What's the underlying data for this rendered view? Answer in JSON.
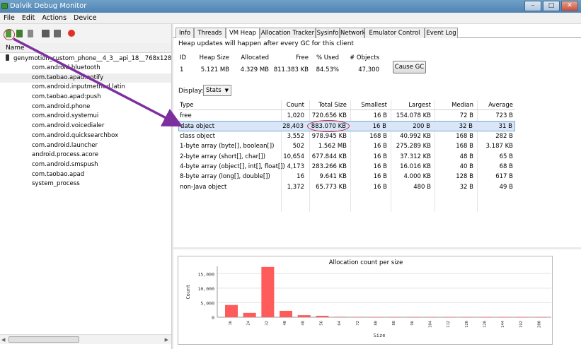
{
  "window": {
    "title": "Dalvik Debug Monitor",
    "controls": [
      "minimize-icon",
      "maximize-icon",
      "close-icon"
    ]
  },
  "menu": [
    "File",
    "Edit",
    "Actions",
    "Device"
  ],
  "left": {
    "toolbar_icons": [
      "update-heap-icon",
      "update-threads-icon",
      "dump-hprof-icon",
      "cause-gc-icon",
      "method-profiling-icon",
      "stop-process-icon"
    ],
    "name_header": "Name",
    "device": "genymotion_custom_phone__4_3__api_18__768x128",
    "clients": [
      "com.android.bluetooth",
      "com.taobao.apad:notify",
      "com.android.inputmethod.latin",
      "com.taobao.apad:push",
      "com.android.phone",
      "com.android.systemui",
      "com.android.voicedialer",
      "com.android.quicksearchbox",
      "com.android.launcher",
      "android.process.acore",
      "com.android.smspush",
      "com.taobao.apad",
      "system_process"
    ],
    "selected_client": 1
  },
  "tabs": [
    "Info",
    "Threads",
    "VM Heap",
    "Allocation Tracker",
    "Sysinfo",
    "Network",
    "Emulator Control",
    "Event Log"
  ],
  "active_tab": "VM Heap",
  "heap": {
    "note": "Heap updates will happen after every GC for this client",
    "summary_headers": [
      "ID",
      "Heap Size",
      "Allocated",
      "Free",
      "% Used",
      "# Objects"
    ],
    "summary_values": [
      "1",
      "5.121 MB",
      "4.329 MB",
      "811.383 KB",
      "84.53%",
      "47,300"
    ],
    "cause_gc": "Cause GC",
    "display_label": "Display:",
    "display_value": "Stats",
    "table_headers": [
      "Type",
      "Count",
      "Total Size",
      "Smallest",
      "Largest",
      "Median",
      "Average"
    ],
    "rows": [
      [
        "free",
        "1,020",
        "720.656 KB",
        "16 B",
        "154.078 KB",
        "72 B",
        "723 B"
      ],
      [
        "data object",
        "28,403",
        "883.070 KB",
        "16 B",
        "200 B",
        "32 B",
        "31 B"
      ],
      [
        "class object",
        "3,552",
        "978.945 KB",
        "168 B",
        "40.992 KB",
        "168 B",
        "282 B"
      ],
      [
        "1-byte array (byte[], boolean[])",
        "502",
        "1.562 MB",
        "16 B",
        "275.289 KB",
        "168 B",
        "3.187 KB"
      ],
      [
        "2-byte array (short[], char[])",
        "10,654",
        "677.844 KB",
        "16 B",
        "37.312 KB",
        "48 B",
        "65 B"
      ],
      [
        "4-byte array (object[], int[], float[])",
        "4,173",
        "283.266 KB",
        "16 B",
        "16.016 KB",
        "40 B",
        "68 B"
      ],
      [
        "8-byte array (long[], double[])",
        "16",
        "9.641 KB",
        "16 B",
        "4.000 KB",
        "128 B",
        "617 B"
      ],
      [
        "non-Java object",
        "1,372",
        "65.773 KB",
        "16 B",
        "480 B",
        "32 B",
        "49 B"
      ]
    ],
    "selected_row": 1
  },
  "colors": {
    "bar": "#ff5b5b",
    "annotation": "#7d2fa0",
    "highlight": "#c0304a"
  },
  "chart_data": {
    "type": "bar",
    "title": "Allocation count per size",
    "xlabel": "Size",
    "ylabel": "Count",
    "ylim": [
      0,
      17500
    ],
    "yticks": [
      "0",
      "5,000",
      "10,000",
      "15,000"
    ],
    "categories": [
      "16",
      "24",
      "32",
      "40",
      "48",
      "56",
      "64",
      "72",
      "80",
      "88",
      "96",
      "104",
      "112",
      "120",
      "128",
      "144",
      "192",
      "200"
    ],
    "values": [
      4200,
      1500,
      17300,
      2200,
      700,
      500,
      150,
      60,
      40,
      30,
      30,
      20,
      20,
      15,
      15,
      10,
      10,
      10
    ],
    "grid": true
  }
}
